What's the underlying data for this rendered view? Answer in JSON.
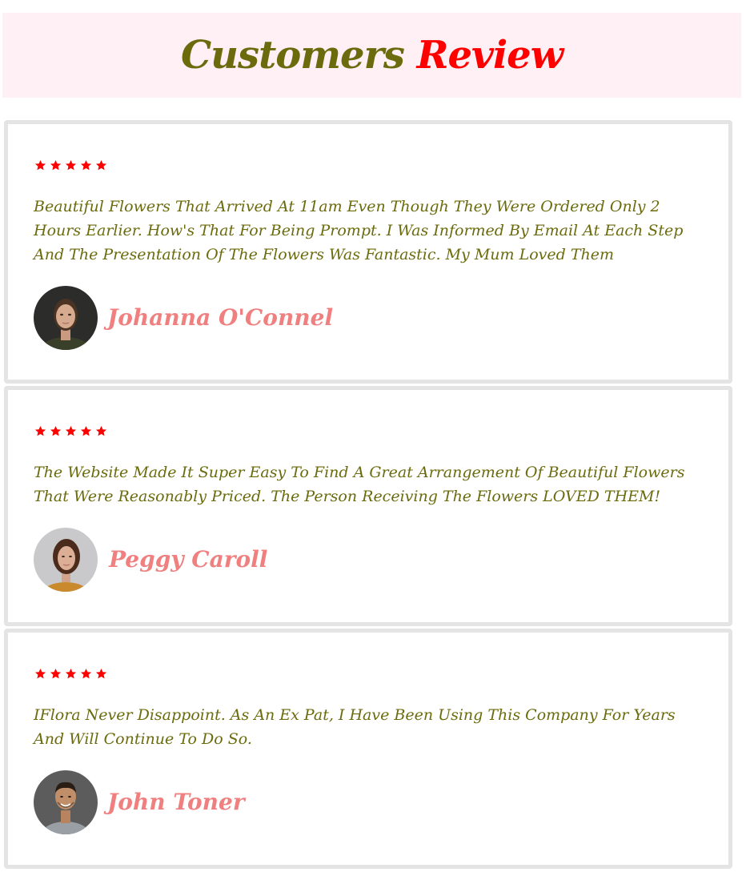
{
  "header": {
    "title_main": "Customers",
    "title_accent": "Review"
  },
  "colors": {
    "title_main": "#6b6b0e",
    "title_accent": "#ff0000",
    "star": "#ff0000",
    "review_text": "#6b6b0e",
    "reviewer_name": "#f08080",
    "header_bg": "#fff0f5",
    "card_border": "#e4e4e4"
  },
  "reviews": [
    {
      "rating": 5,
      "text": "Beautiful Flowers That Arrived At 11am Even Though They Were Ordered Only 2 Hours Earlier. How's That For Being Prompt. I Was Informed By Email At Each Step And The Presentation Of The Flowers Was Fantastic. My Mum Loved Them",
      "name": "Johanna O'Connel",
      "avatar_icon": "woman-portrait-dark-background"
    },
    {
      "rating": 5,
      "text": "The Website Made It Super Easy To Find A Great Arrangement Of Beautiful Flowers That Were Reasonably Priced. The Person Receiving The Flowers LOVED THEM!",
      "name": "Peggy Caroll",
      "avatar_icon": "woman-portrait-light-background"
    },
    {
      "rating": 5,
      "text": "IFlora Never Disappoint. As An Ex Pat, I Have Been Using This Company For Years And Will Continue To Do So.",
      "name": "John Toner",
      "avatar_icon": "man-portrait-grey-background"
    }
  ]
}
